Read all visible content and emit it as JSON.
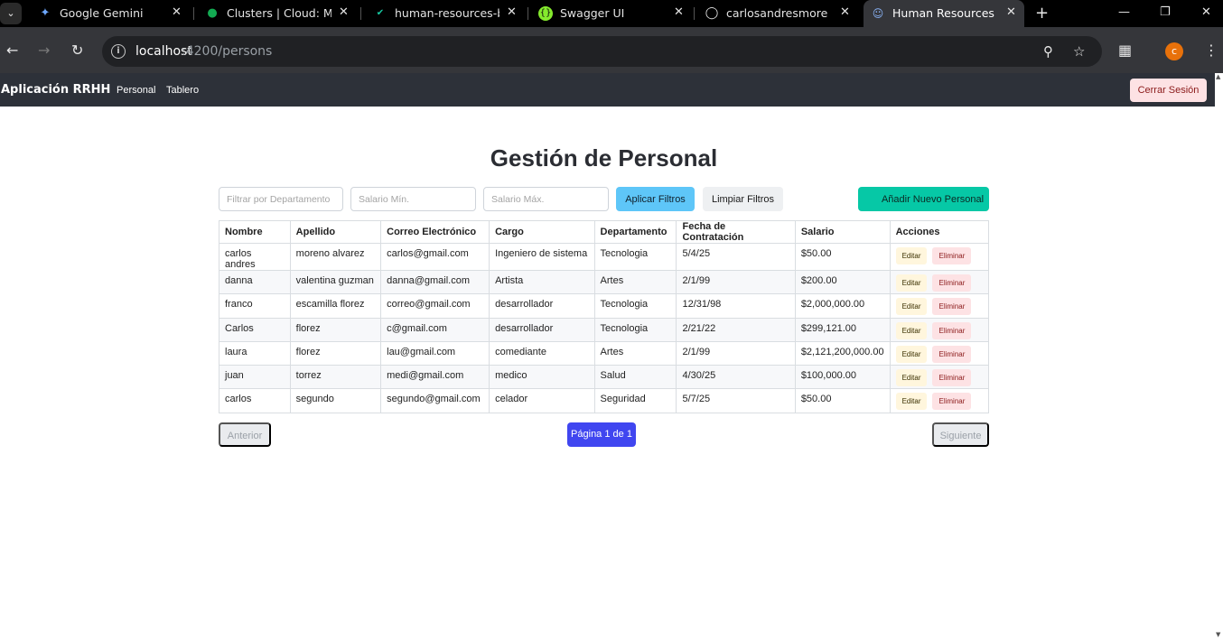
{
  "browser": {
    "tabs": [
      {
        "title": "Google Gemini",
        "icon": "gemini-icon"
      },
      {
        "title": "Clusters | Cloud: Mon",
        "icon": "mongodb-leaf-icon"
      },
      {
        "title": "human-resources-bac",
        "icon": "render-check-icon"
      },
      {
        "title": "Swagger UI",
        "icon": "swagger-icon"
      },
      {
        "title": "carlosandresmoreno/",
        "icon": "github-icon"
      },
      {
        "title": "Human Resources",
        "icon": "people-icon"
      }
    ],
    "url_host": "localhost",
    "url_path": ":4200/persons",
    "profile_initial": "c",
    "colors": {
      "profile": "#e8710a"
    }
  },
  "app": {
    "brand": "Aplicación RRHH",
    "nav": [
      "Personal",
      "Tablero"
    ],
    "logout_label": "Cerrar Sesión"
  },
  "main": {
    "title": "Gestión de Personal",
    "filters": {
      "department_placeholder": "Filtrar por Departamento",
      "salary_min_placeholder": "Salario Mín.",
      "salary_max_placeholder": "Salario Máx.",
      "apply_label": "Aplicar Filtros",
      "clear_label": "Limpiar Filtros"
    },
    "add_label": "Añadir Nuevo Personal",
    "table": {
      "headers": [
        "Nombre",
        "Apellido",
        "Correo Electrónico",
        "Cargo",
        "Departamento",
        "Fecha de Contratación",
        "Salario",
        "Acciones"
      ],
      "edit_label": "Editar",
      "delete_label": "Eliminar",
      "rows": [
        [
          "carlos andres",
          "moreno alvarez",
          "carlos@gmail.com",
          "Ingeniero de sistema",
          "Tecnologia",
          "5/4/25",
          "$50.00"
        ],
        [
          "danna",
          "valentina guzman",
          "danna@gmail.com",
          "Artista",
          "Artes",
          "2/1/99",
          "$200.00"
        ],
        [
          "franco",
          "escamilla florez",
          "correo@gmail.com",
          "desarrollador",
          "Tecnologia",
          "12/31/98",
          "$2,000,000.00"
        ],
        [
          "Carlos",
          "florez",
          "c@gmail.com",
          "desarrollador",
          "Tecnologia",
          "2/21/22",
          "$299,121.00"
        ],
        [
          "laura",
          "florez",
          "lau@gmail.com",
          "comediante",
          "Artes",
          "2/1/99",
          "$2,121,200,000.00"
        ],
        [
          "juan",
          "torrez",
          "medi@gmail.com",
          "medico",
          "Salud",
          "4/30/25",
          "$100,000.00"
        ],
        [
          "carlos",
          "segundo",
          "segundo@gmail.com",
          "celador",
          "Seguridad",
          "5/7/25",
          "$50.00"
        ]
      ]
    },
    "pagination": {
      "prev_label": "Anterior",
      "page_label": "Página 1 de 1",
      "next_label": "Siguiente"
    }
  }
}
